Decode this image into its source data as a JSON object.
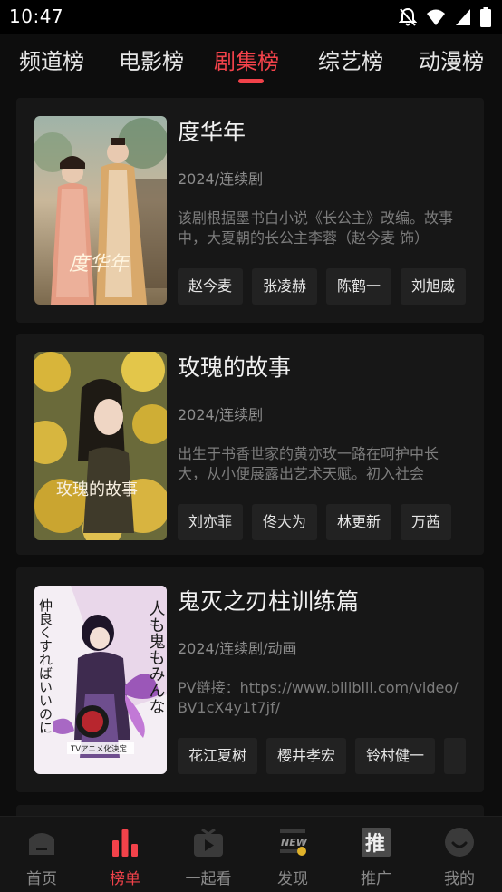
{
  "status_bar": {
    "time": "10:47",
    "icons": [
      "notifications-off-icon",
      "wifi-icon",
      "cellular-signal-icon",
      "battery-icon"
    ]
  },
  "tabs": [
    {
      "label": "频道榜",
      "active": false
    },
    {
      "label": "电影榜",
      "active": false
    },
    {
      "label": "剧集榜",
      "active": true
    },
    {
      "label": "综艺榜",
      "active": false
    },
    {
      "label": "动漫榜",
      "active": false
    }
  ],
  "items": [
    {
      "title": "度华年",
      "meta": "2024/连续剧",
      "description": "该剧根据墨书白小说《长公主》改编。故事中，大夏朝的长公主李蓉（赵今麦 饰）",
      "cast": [
        "赵今麦",
        "张凌赫",
        "陈鹤一",
        "刘旭威"
      ],
      "poster_text": "度华年"
    },
    {
      "title": "玫瑰的故事",
      "meta": "2024/连续剧",
      "description": "出生于书香世家的黄亦玫一路在呵护中长大，从小便展露出艺术天赋。初入社会",
      "cast": [
        "刘亦菲",
        "佟大为",
        "林更新",
        "万茜"
      ],
      "poster_text": "玫瑰的故事"
    },
    {
      "title": "鬼灭之刃柱训练篇",
      "meta": "2024/连续剧/动画",
      "description": "PV链接：https://www.bilibili.com/video/BV1cX4y1t7jf/",
      "cast": [
        "花江夏树",
        "樱井孝宏",
        "铃村健一",
        ""
      ],
      "poster_text_right": "人も鬼もみんな",
      "poster_text_left": "仲良くすればいいのに",
      "poster_badge": "TVアニメ化決定"
    }
  ],
  "bottom_nav": [
    {
      "label": "首页",
      "icon": "home-icon",
      "active": false
    },
    {
      "label": "榜单",
      "icon": "ranking-chart-icon",
      "active": true
    },
    {
      "label": "一起看",
      "icon": "tv-play-icon",
      "active": false
    },
    {
      "label": "发现",
      "icon": "new-discover-icon",
      "active": false
    },
    {
      "label": "推广",
      "icon": "promote-icon",
      "active": false
    },
    {
      "label": "我的",
      "icon": "profile-smile-icon",
      "active": false
    }
  ],
  "colors": {
    "accent": "#f2424a",
    "background": "#0d0d0d",
    "card": "#171717",
    "chip": "#222222"
  }
}
